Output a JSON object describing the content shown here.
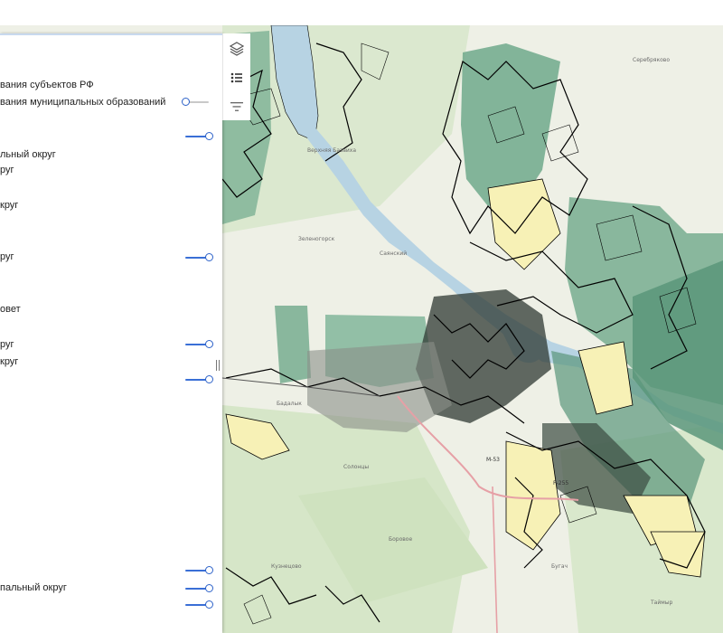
{
  "map": {
    "place_labels": [
      "Верхняя Базаиха",
      "Зеленогорск",
      "Саянский",
      "Бадалык",
      "Солонцы",
      "Кузнецово",
      "Серебряково",
      "Боровое",
      "Бугач",
      "Таймыр"
    ],
    "road_labels": [
      "М-53",
      "Р-255"
    ],
    "colors": {
      "land": "#eef0e6",
      "forest": "#d4e6c6",
      "river": "#b7d3e3",
      "polygon_green": "#6fa98b",
      "polygon_dark": "#3f7d60",
      "parcel_yellow": "#f7f1b6",
      "boundary": "#000000"
    }
  },
  "panel": {
    "layers": [
      {
        "label": "вания субъектов РФ",
        "slider": null
      },
      {
        "label": "вания муниципальных образований",
        "slider": "off"
      },
      {
        "label": "",
        "slider": "on"
      },
      {
        "label": "льный округ",
        "slider": null
      },
      {
        "label": "руг",
        "slider": null
      },
      {
        "label": "круг",
        "slider": null
      },
      {
        "label": "руг",
        "slider": "on"
      },
      {
        "label": "овет",
        "slider": null
      },
      {
        "label": "руг",
        "slider": "on"
      },
      {
        "label": "круг",
        "slider": null
      },
      {
        "label": "",
        "slider": "on"
      },
      {
        "label": "",
        "slider": "on"
      },
      {
        "label": "пальный округ",
        "slider": "on"
      },
      {
        "label": "",
        "slider": "on"
      }
    ]
  },
  "toolbar": {
    "buttons": [
      {
        "name": "layers-icon"
      },
      {
        "name": "list-icon"
      },
      {
        "name": "filter-icon"
      }
    ]
  }
}
